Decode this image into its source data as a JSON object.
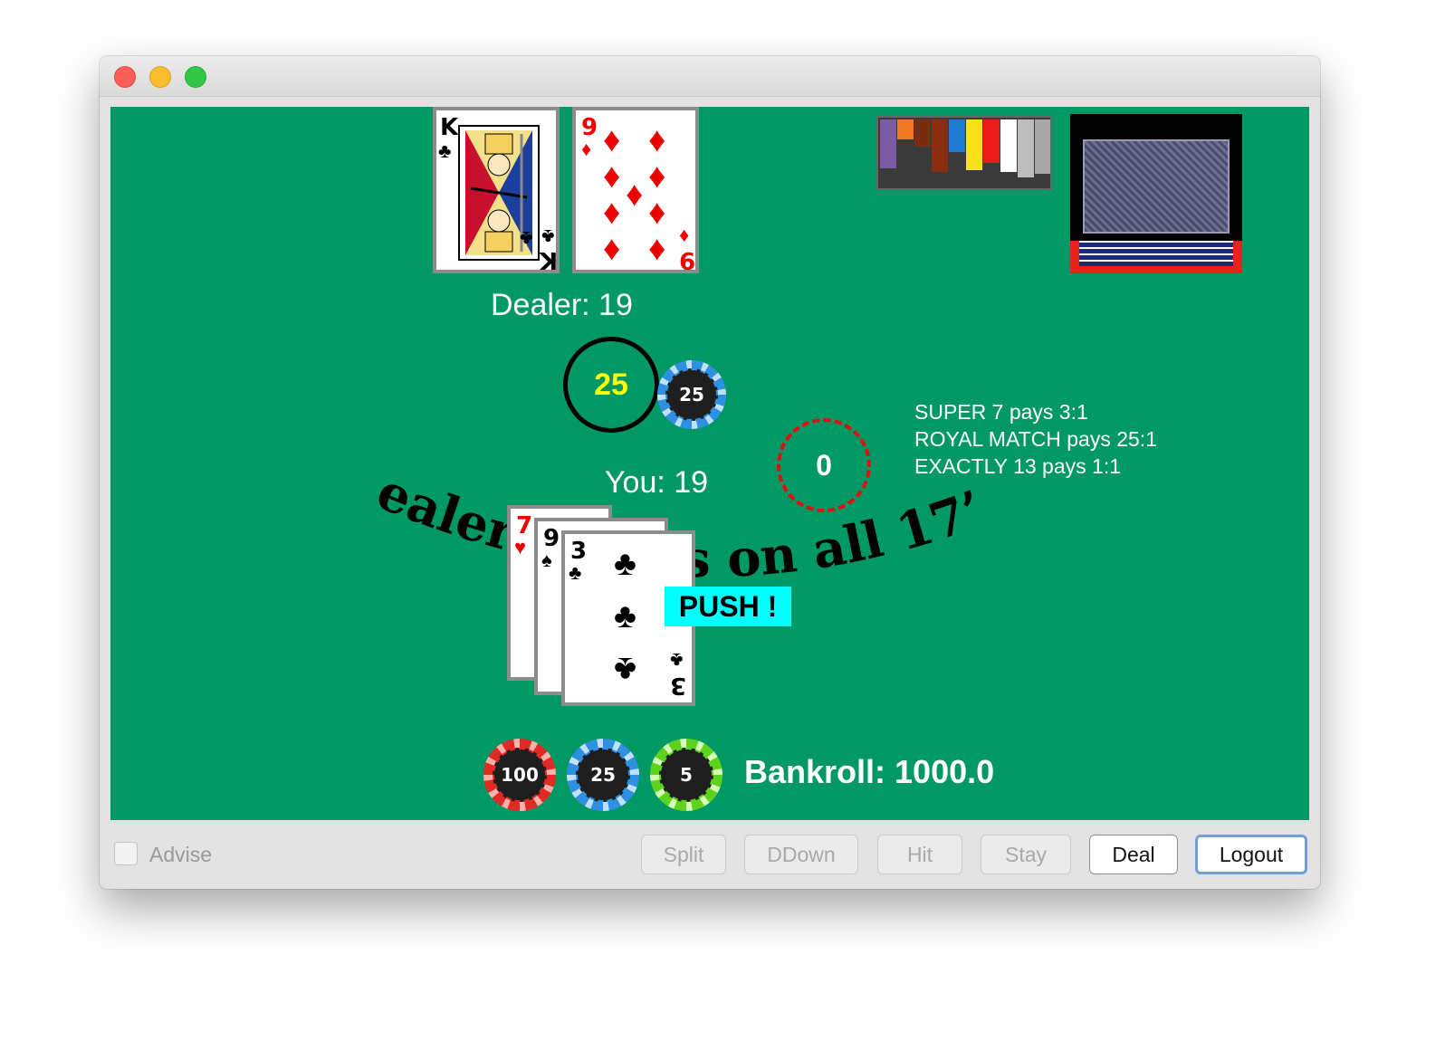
{
  "window": {
    "controls": [
      "close",
      "minimize",
      "zoom"
    ]
  },
  "dealer": {
    "label": "Dealer: 19",
    "cards": [
      {
        "rank": "K",
        "suit": "♣",
        "color": "black"
      },
      {
        "rank": "9",
        "suit": "♦",
        "color": "red"
      }
    ]
  },
  "player": {
    "label": "You: 19",
    "cards": [
      {
        "rank": "7",
        "suit": "♥",
        "color": "red"
      },
      {
        "rank": "9",
        "suit": "♠",
        "color": "black"
      },
      {
        "rank": "3",
        "suit": "♣",
        "color": "black"
      }
    ]
  },
  "bet": {
    "main": "25",
    "side": "0",
    "main_chip": "25"
  },
  "side_bets": {
    "line1": "SUPER 7 pays 3:1",
    "line2": "ROYAL MATCH pays 25:1",
    "line3": "EXACTLY 13 pays 1:1"
  },
  "table_text": {
    "arc": "Dealer stands on all 17’s",
    "result": "PUSH !"
  },
  "chips": [
    {
      "value": "100",
      "color": "#e02a26"
    },
    {
      "value": "25",
      "color": "#2f8fe0"
    },
    {
      "value": "5",
      "color": "#5fd21e"
    }
  ],
  "bankroll": "Bankroll: 1000.0",
  "toolbar": {
    "advise_label": "Advise",
    "split_label": "Split",
    "ddown_label": "DDown",
    "hit_label": "Hit",
    "stay_label": "Stay",
    "deal_label": "Deal",
    "logout_label": "Logout"
  },
  "colors": {
    "felt": "#009966",
    "bet_text": "#ffff00",
    "push_bg": "#00ffff",
    "side_ring": "#e01010"
  }
}
